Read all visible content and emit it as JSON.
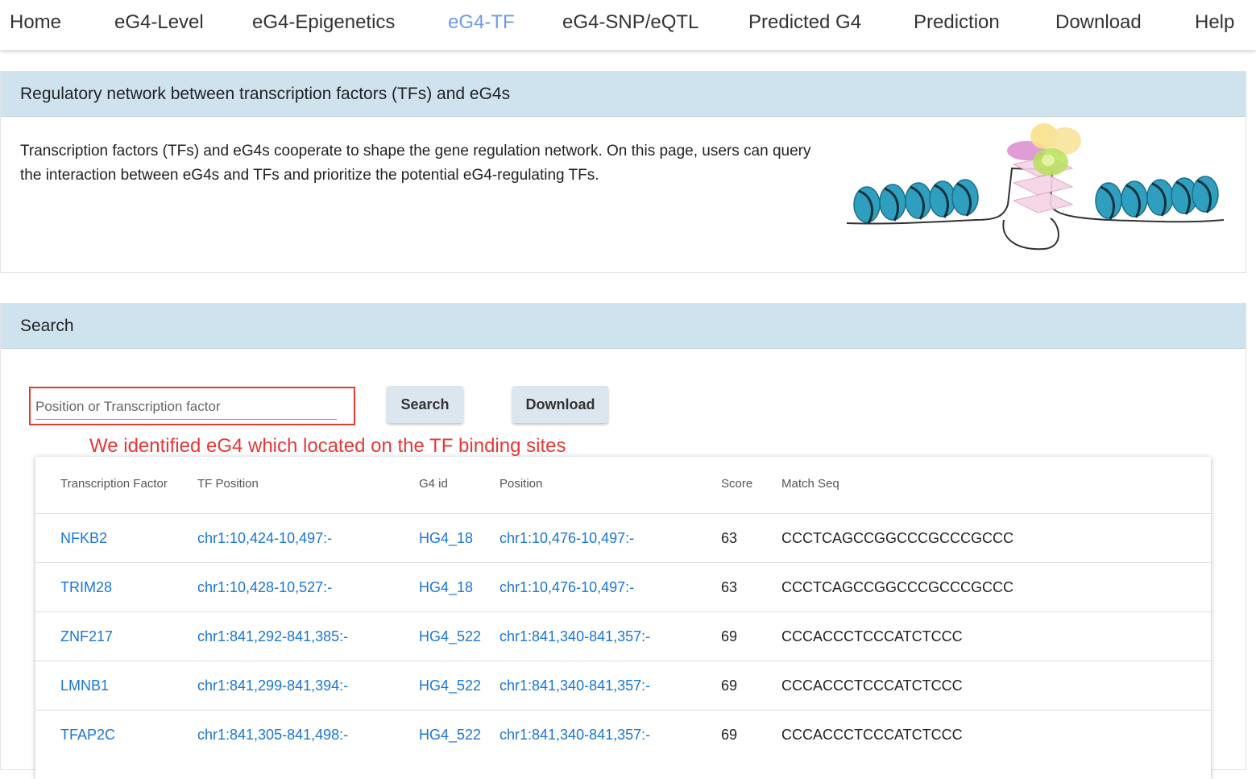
{
  "nav": {
    "items": [
      {
        "label": "Home"
      },
      {
        "label": "eG4-Level"
      },
      {
        "label": "eG4-Epigenetics"
      },
      {
        "label": "eG4-TF"
      },
      {
        "label": "eG4-SNP/eQTL"
      },
      {
        "label": "Predicted G4"
      },
      {
        "label": "Prediction"
      },
      {
        "label": "Download"
      },
      {
        "label": "Help"
      }
    ],
    "active": "eG4-TF"
  },
  "intro": {
    "title": "Regulatory network between transcription factors (TFs) and eG4s",
    "text": "Transcription factors (TFs) and eG4s cooperate to shape the gene regulation network. On this page, users can query the interaction between eG4s and TFs and prioritize the potential eG4-regulating TFs."
  },
  "search": {
    "title": "Search",
    "placeholder": "Position or Transcription factor",
    "search_label": "Search",
    "download_label": "Download",
    "annotation": "We identified eG4 which located on the TF binding sites"
  },
  "table": {
    "headers": [
      "Transcription Factor",
      "TF Position",
      "G4 id",
      "Position",
      "Score",
      "Match Seq"
    ],
    "rows": [
      {
        "tf": "NFKB2",
        "tf_position": "chr1:10,424-10,497:-",
        "g4_id": "HG4_18",
        "position": "chr1:10,476-10,497:-",
        "score": "63",
        "match_seq": "CCCTCAGCCGGCCCGCCCGCCC"
      },
      {
        "tf": "TRIM28",
        "tf_position": "chr1:10,428-10,527:-",
        "g4_id": "HG4_18",
        "position": "chr1:10,476-10,497:-",
        "score": "63",
        "match_seq": "CCCTCAGCCGGCCCGCCCGCCC"
      },
      {
        "tf": "ZNF217",
        "tf_position": "chr1:841,292-841,385:-",
        "g4_id": "HG4_522",
        "position": "chr1:841,340-841,357:-",
        "score": "69",
        "match_seq": "CCCACCCTCCCATCTCCC"
      },
      {
        "tf": "LMNB1",
        "tf_position": "chr1:841,299-841,394:-",
        "g4_id": "HG4_522",
        "position": "chr1:841,340-841,357:-",
        "score": "69",
        "match_seq": "CCCACCCTCCCATCTCCC"
      },
      {
        "tf": "TFAP2C",
        "tf_position": "chr1:841,305-841,498:-",
        "g4_id": "HG4_522",
        "position": "chr1:841,340-841,357:-",
        "score": "69",
        "match_seq": "CCCACCCTCCCATCTCCC"
      }
    ]
  },
  "colors": {
    "accent": "#6e9be8",
    "link": "#1976d2",
    "panel_header": "#cfe3ef",
    "annotation": "#e53935"
  }
}
